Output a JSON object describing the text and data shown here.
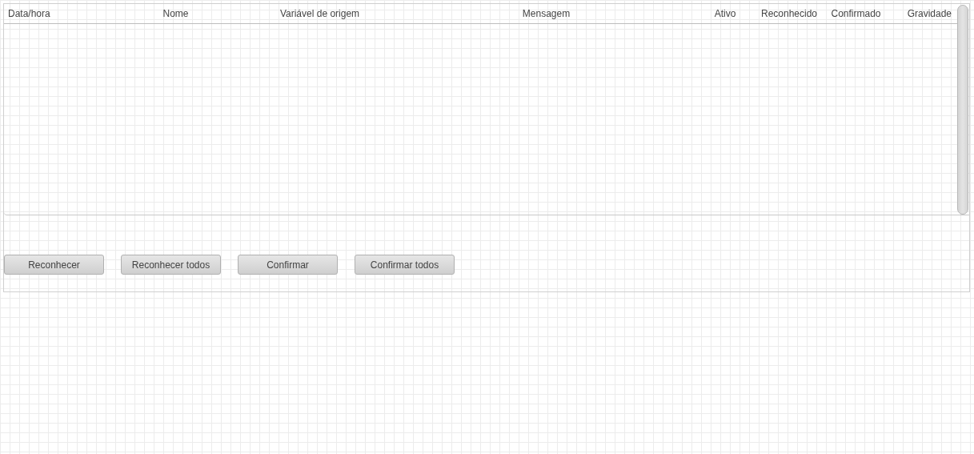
{
  "table": {
    "columns": [
      "Data/hora",
      "Nome",
      "Variável de origem",
      "Mensagem",
      "Ativo",
      "Reconhecido",
      "Confirmado",
      "Gravidade"
    ]
  },
  "buttons": [
    "Reconhecer",
    "Reconhecer todos",
    "Confirmar",
    "Confirmar todos"
  ]
}
